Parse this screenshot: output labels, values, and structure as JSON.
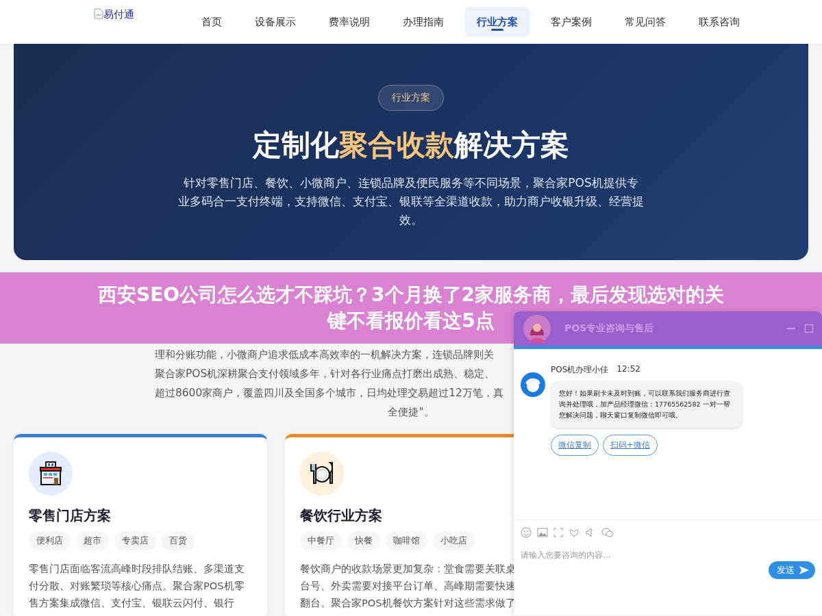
{
  "header": {
    "logo_alt": "易付通",
    "nav": [
      {
        "label": "首页",
        "selected": false
      },
      {
        "label": "设备展示",
        "selected": false
      },
      {
        "label": "费率说明",
        "selected": false
      },
      {
        "label": "办理指南",
        "selected": false
      },
      {
        "label": "行业方案",
        "selected": true
      },
      {
        "label": "客户案例",
        "selected": false
      },
      {
        "label": "常见问答",
        "selected": false
      },
      {
        "label": "联系咨询",
        "selected": false
      }
    ]
  },
  "hero": {
    "badge": "行业方案",
    "title_parts": [
      {
        "text": "定制化",
        "highlight": false
      },
      {
        "text": "聚合收款",
        "highlight": true
      },
      {
        "text": "解决方案",
        "highlight": false
      }
    ],
    "description": "针对零售门店、餐饮、小微商户、连锁品牌及便民服务等不同场景，聚合家POS机提供专业多码合一支付终端，支持微信、支付宝、银联等全渠道收款，助力商户收银升级、经营提效。"
  },
  "intro": {
    "lines": [
      {
        "text": "理和分账功能，小微商户追求低成本高效率的一机解决方案，连锁品牌则关",
        "kind": "cut"
      },
      {
        "text": "聚合家POS机深耕聚合支付领域多年，针对各行业痛点打磨出成熟、稳定、",
        "kind": "cut"
      },
      {
        "text": "超过8600家商户，覆盖四川及全国多个城市，日均处理交易超过12万笔，真",
        "kind": "cut"
      },
      {
        "text": "全便捷\"。",
        "kind": "end"
      }
    ]
  },
  "cards": [
    {
      "kind": "store",
      "color": "#3b7ddd",
      "title": "零售门店方案",
      "tags": [
        "便利店",
        "超市",
        "专卖店",
        "百货"
      ],
      "desc_lines": [
        "零售门店面临客流高峰时段排队结账、多渠道支",
        "付分散、对账繁琐等核心痛点。聚合家POS机零",
        "售方案集成微信、支付宝、银联云闪付、银行"
      ]
    },
    {
      "kind": "dining",
      "color": "#f08a24",
      "title": "餐饮行业方案",
      "tags": [
        "中餐厅",
        "快餐",
        "咖啡馆",
        "小吃店"
      ],
      "desc_lines": [
        "餐饮商户的收款场景更加复杂：堂食需要关联桌",
        "台号、外卖需要对接平台订单、高峰期需要快速",
        "翻台。聚合家POS机餐饮方案针对这些需求做了"
      ]
    }
  ],
  "banner": {
    "title_lines": [
      "西安SEO公司怎么选才不踩坑？3个月换了2家服务商，最后发现选对的关",
      "键不看报价看这5点"
    ]
  },
  "chat": {
    "title": "POS专业咨询与售后",
    "agent": "POS机办理小佳",
    "time": "12:52",
    "message": "您好！如果刷卡未及时到账，可以联系我们服务商进行查询并处理哦，加产品经理微信：17765562582 一对一帮您解决问题，聊天窗口复制微信即可哦。",
    "actions": [
      "微信复制",
      "扫码+微信"
    ],
    "placeholder": "请输入您要咨询的内容...",
    "send": "发送"
  }
}
